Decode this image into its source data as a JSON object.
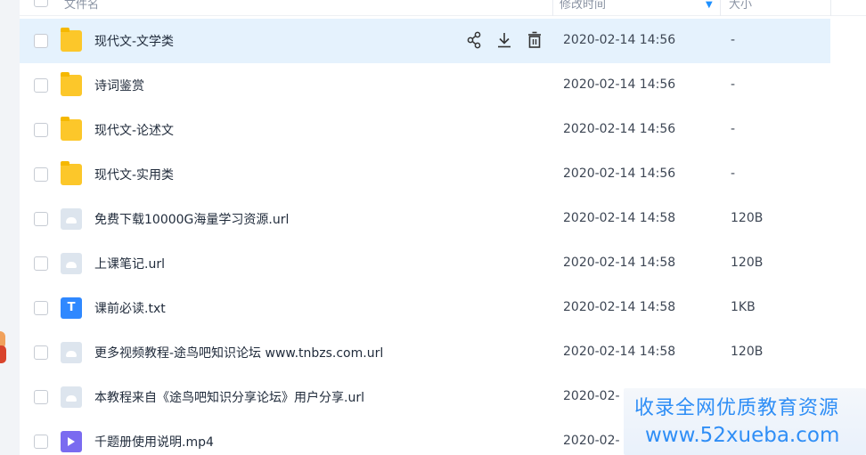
{
  "header": {
    "name": "文件名",
    "modified": "修改时间",
    "size": "大小"
  },
  "rows": [
    {
      "name": "现代文-文学类",
      "time": "2020-02-14 14:56",
      "size": "-",
      "type": "folder"
    },
    {
      "name": "诗词鉴赏",
      "time": "2020-02-14 14:56",
      "size": "-",
      "type": "folder"
    },
    {
      "name": "现代文-论述文",
      "time": "2020-02-14 14:56",
      "size": "-",
      "type": "folder"
    },
    {
      "name": "现代文-实用类",
      "time": "2020-02-14 14:56",
      "size": "-",
      "type": "folder"
    },
    {
      "name": "免费下载10000G海量学习资源.url",
      "time": "2020-02-14 14:58",
      "size": "120B",
      "type": "url"
    },
    {
      "name": "上课笔记.url",
      "time": "2020-02-14 14:58",
      "size": "120B",
      "type": "url"
    },
    {
      "name": "课前必读.txt",
      "time": "2020-02-14 14:58",
      "size": "1KB",
      "type": "txt",
      "icon_letter": "T"
    },
    {
      "name": "更多视频教程-途鸟吧知识论坛 www.tnbzs.com.url",
      "time": "2020-02-14 14:58",
      "size": "120B",
      "type": "url"
    },
    {
      "name": "本教程来自《途鸟吧知识分享论坛》用户分享.url",
      "time": "2020-02-",
      "size": "",
      "type": "url"
    },
    {
      "name": "千题册使用说明.mp4",
      "time": "2020-02-",
      "size": "",
      "type": "mp4"
    }
  ],
  "hover_actions": [
    "share-icon",
    "download-icon",
    "delete-icon"
  ],
  "watermark": {
    "line1": "收录全网优质教育资源",
    "line2": "www.52xueba.com"
  },
  "colors": {
    "hover_row": "#e5f2fd",
    "folder": "#fcc72a",
    "accent": "#2f8ef6"
  }
}
